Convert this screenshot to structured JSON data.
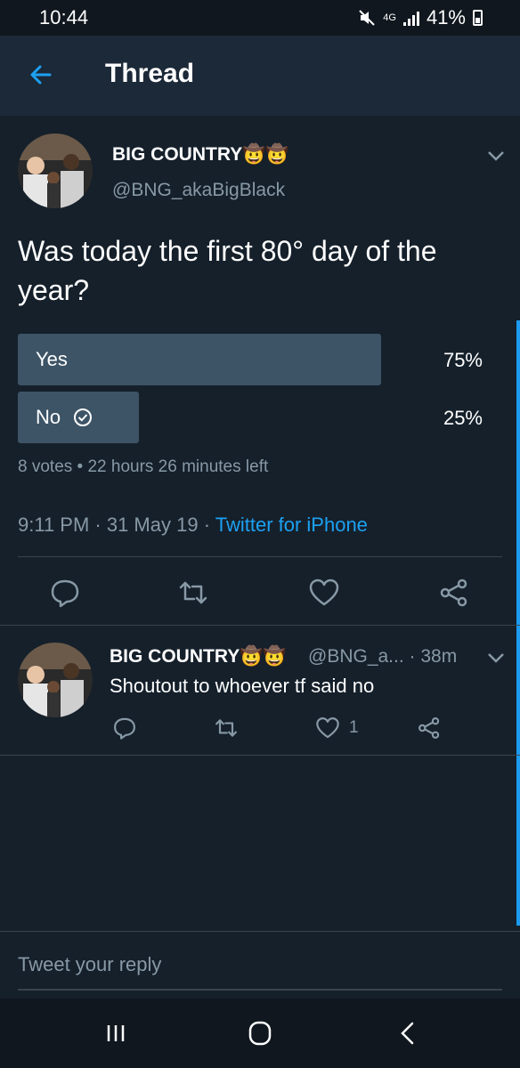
{
  "status": {
    "time": "10:44",
    "network": "4G",
    "battery": "41%"
  },
  "header": {
    "title": "Thread"
  },
  "main_tweet": {
    "author_name": "BIG COUNTRY🤠🤠",
    "handle": "@BNG_akaBigBlack",
    "text": "Was today the first 80° day of the year?",
    "poll": {
      "options": [
        {
          "label": "Yes",
          "percent": "75%",
          "fraction": 0.75,
          "selected": false
        },
        {
          "label": "No",
          "percent": "25%",
          "fraction": 0.25,
          "selected": true
        }
      ],
      "meta": "8 votes • 22 hours 26 minutes left"
    },
    "time": "9:11 PM · 31 May 19 · ",
    "source": "Twitter for iPhone"
  },
  "reply_tweet": {
    "author_name": "BIG COUNTRY🤠🤠",
    "handle_time": "@BNG_a... · 38m",
    "text": "Shoutout to whoever tf said no",
    "like_count": "1"
  },
  "composer": {
    "placeholder": "Tweet your reply"
  },
  "icons": {
    "back": "arrow-left-icon",
    "chevron": "chevron-down-icon",
    "reply": "comment-icon",
    "retweet": "retweet-icon",
    "like": "heart-icon",
    "share": "share-icon"
  },
  "colors": {
    "accent": "#1da1f2",
    "background": "#15202b",
    "poll_bar": "#3d5466",
    "muted": "#8899a6"
  }
}
